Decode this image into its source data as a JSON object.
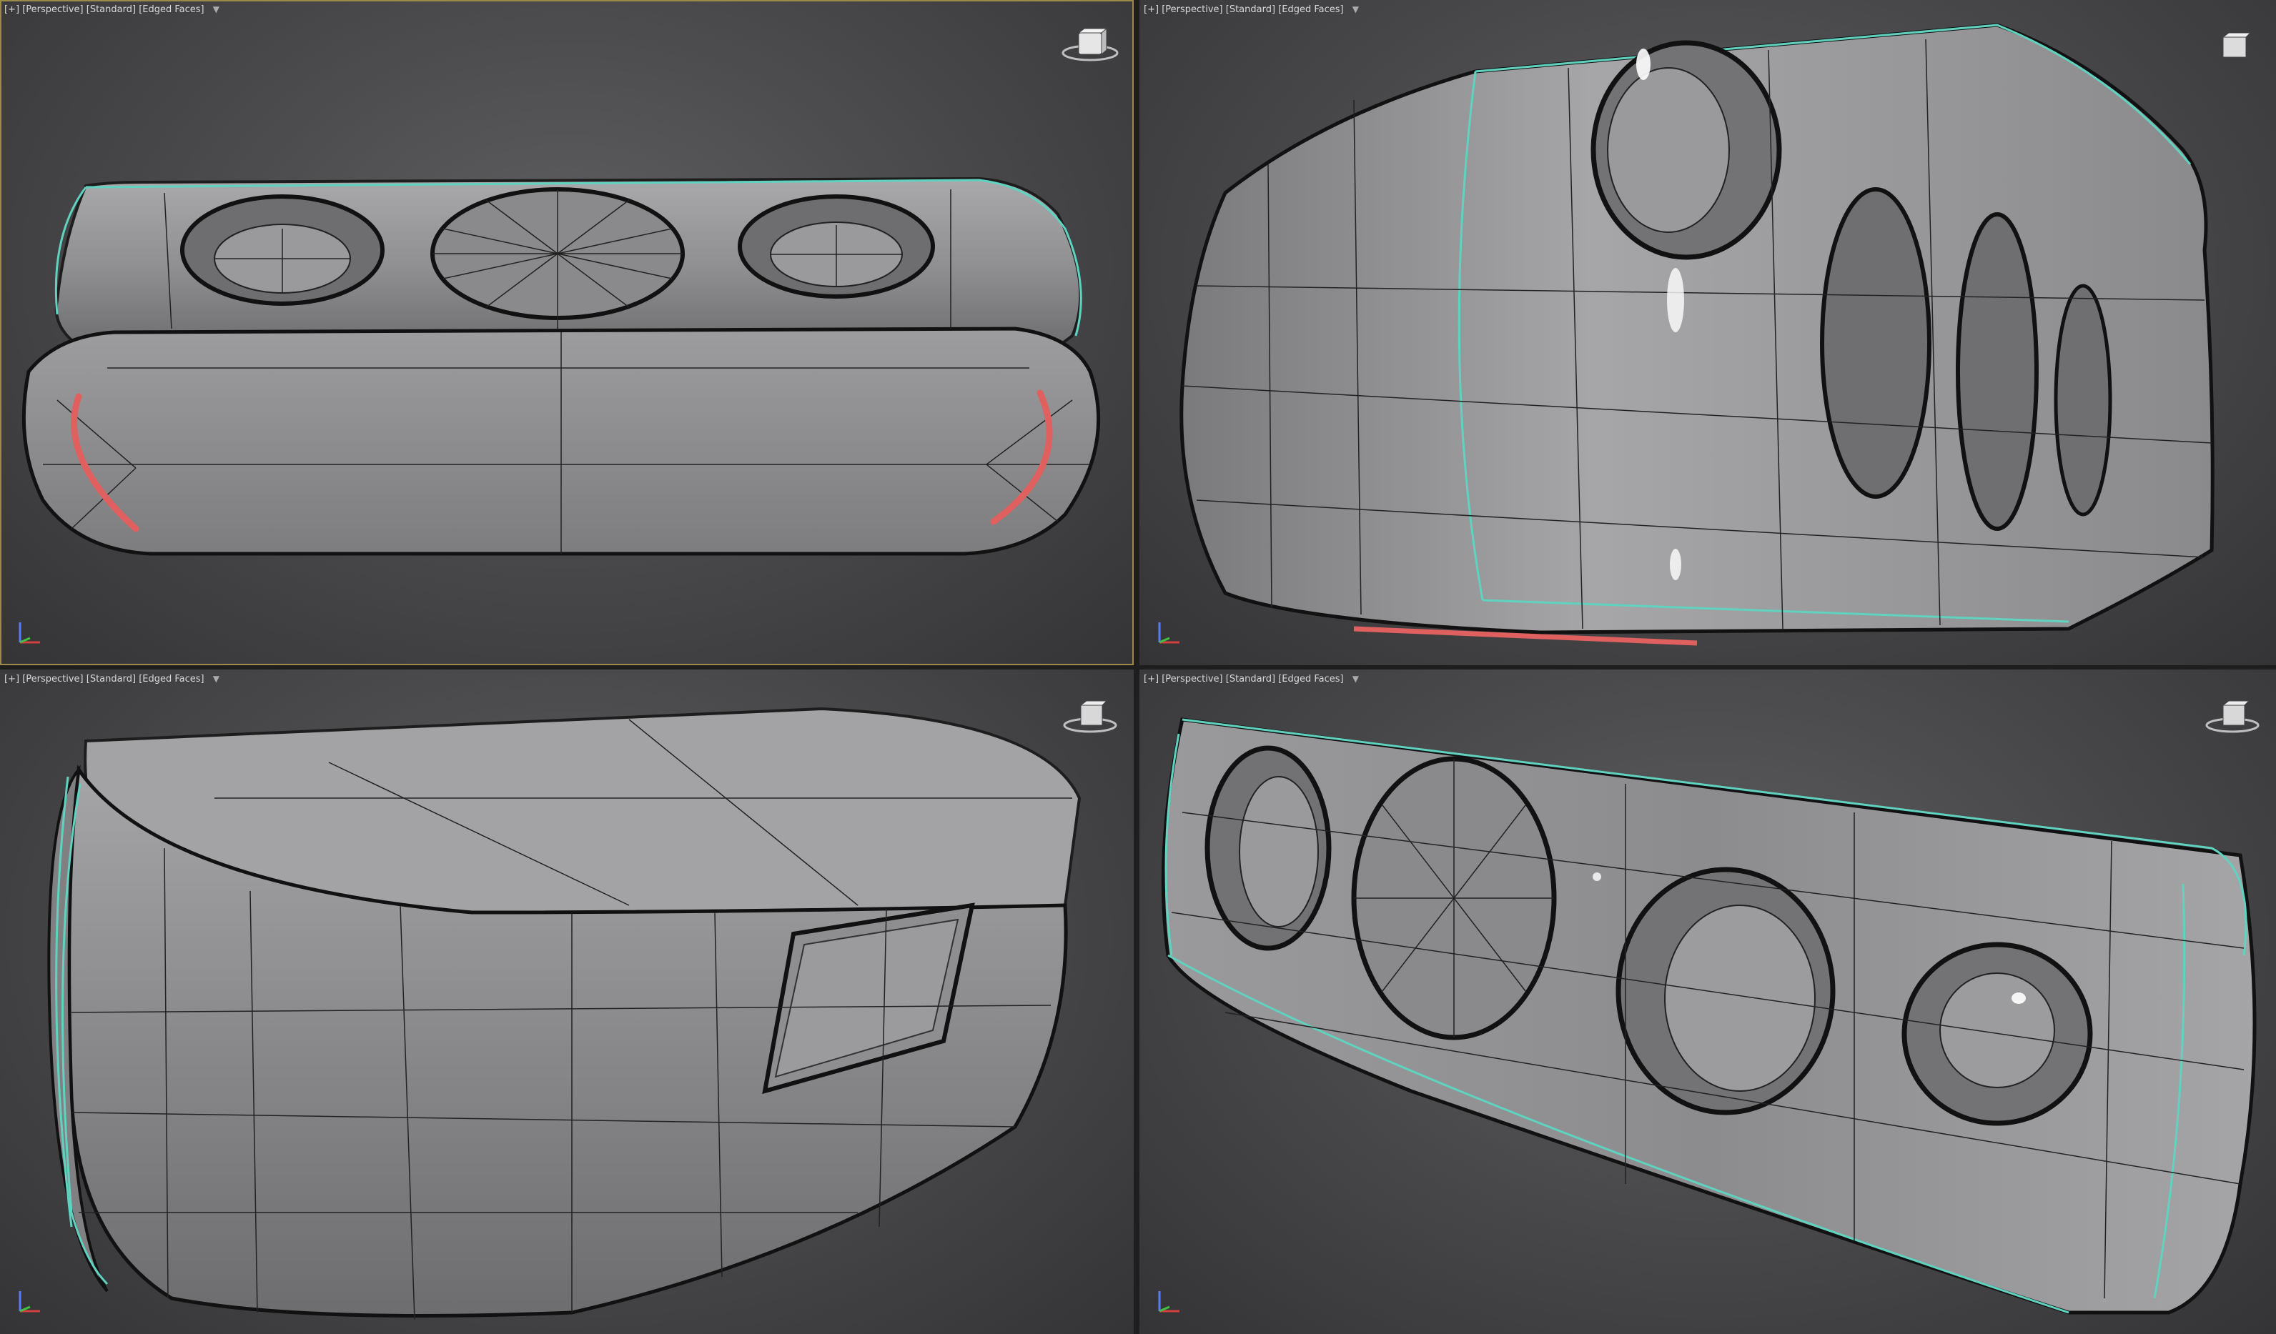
{
  "viewports": [
    {
      "id": "top-left",
      "active": true,
      "labels": {
        "plus": "[+]",
        "view": "[Perspective]",
        "shading": "[Standard]",
        "mode": "[Edged Faces]"
      }
    },
    {
      "id": "top-right",
      "active": false,
      "labels": {
        "plus": "[+]",
        "view": "[Perspective]",
        "shading": "[Standard]",
        "mode": "[Edged Faces]"
      }
    },
    {
      "id": "bottom-left",
      "active": false,
      "labels": {
        "plus": "[+]",
        "view": "[Perspective]",
        "shading": "[Standard]",
        "mode": "[Edged Faces]"
      }
    },
    {
      "id": "bottom-right",
      "active": false,
      "labels": {
        "plus": "[+]",
        "view": "[Perspective]",
        "shading": "[Standard]",
        "mode": "[Edged Faces]"
      }
    }
  ],
  "icons": {
    "filter": "filter-icon",
    "viewcube": "viewcube-icon",
    "axis": "axis-tripod-icon"
  },
  "colors": {
    "active_border": "#9c8a4a",
    "wire": "#222222",
    "seam": "#5fd3bf",
    "selection": "#e06060",
    "mesh_fill": "#8d8d8f"
  }
}
